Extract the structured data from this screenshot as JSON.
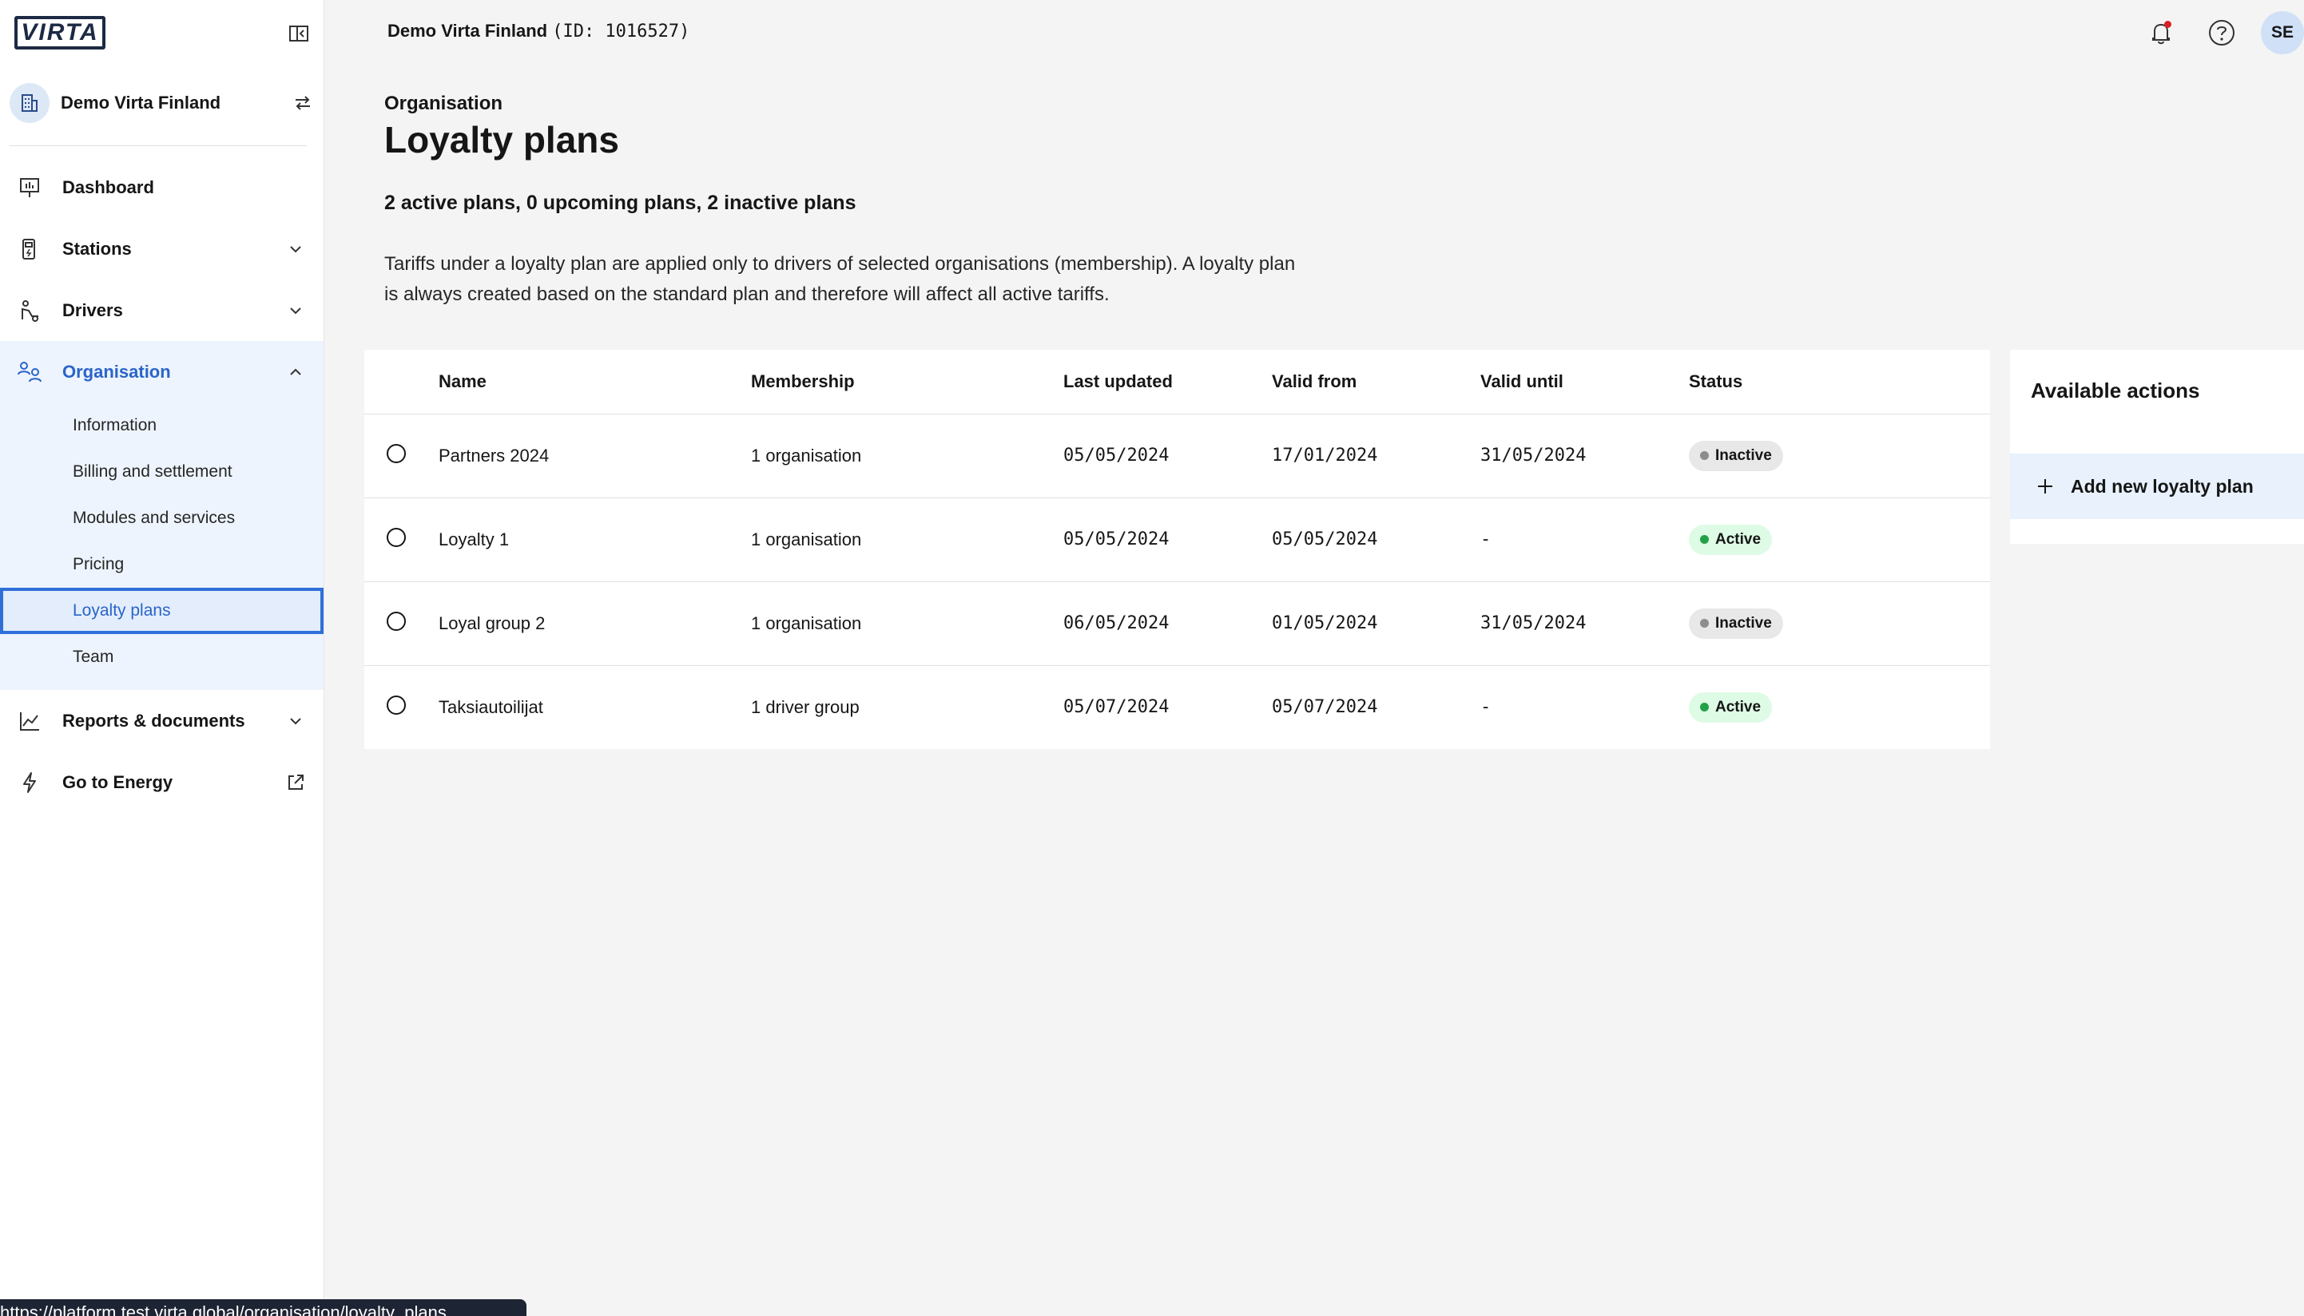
{
  "app": {
    "logo_text": "VIRTA",
    "brand_color": "#1c2a44",
    "accent_color": "#2a64c9"
  },
  "header": {
    "org_name": "Demo Virta Finland",
    "org_id": "(ID: 1016527)",
    "user_initials": "SE"
  },
  "sidebar": {
    "org_name": "Demo Virta Finland",
    "nav": {
      "dashboard": "Dashboard",
      "stations": "Stations",
      "drivers": "Drivers",
      "organisation": "Organisation",
      "reports": "Reports & documents",
      "energy": "Go to Energy"
    },
    "org_sub": [
      "Information",
      "Billing and settlement",
      "Modules and services",
      "Pricing",
      "Loyalty plans",
      "Team"
    ]
  },
  "page": {
    "breadcrumb": "Organisation",
    "title": "Loyalty plans",
    "summary": "2 active plans, 0 upcoming plans, 2 inactive plans",
    "description": "Tariffs under a loyalty plan are applied only to drivers of selected organisations (membership). A loyalty plan is always created based on the standard plan and therefore will affect all active tariffs."
  },
  "table": {
    "headers": {
      "name": "Name",
      "membership": "Membership",
      "last_updated": "Last updated",
      "valid_from": "Valid from",
      "valid_until": "Valid until",
      "status": "Status"
    },
    "rows": [
      {
        "name": "Partners 2024",
        "membership": "1 organisation",
        "last_updated": "05/05/2024",
        "valid_from": "17/01/2024",
        "valid_until": "31/05/2024",
        "status": "Inactive"
      },
      {
        "name": "Loyalty 1",
        "membership": "1 organisation",
        "last_updated": "05/05/2024",
        "valid_from": "05/05/2024",
        "valid_until": "-",
        "status": "Active"
      },
      {
        "name": "Loyal group 2",
        "membership": "1 organisation",
        "last_updated": "06/05/2024",
        "valid_from": "01/05/2024",
        "valid_until": "31/05/2024",
        "status": "Inactive"
      },
      {
        "name": "Taksiautoilijat",
        "membership": "1 driver group",
        "last_updated": "05/07/2024",
        "valid_from": "05/07/2024",
        "valid_until": "-",
        "status": "Active"
      }
    ],
    "status_colors": {
      "Active": {
        "bg": "#defbe6",
        "dot": "#24a148"
      },
      "Inactive": {
        "bg": "#e8e8e8",
        "dot": "#8d8d8d"
      }
    }
  },
  "actions": {
    "title": "Available actions",
    "add_label": "Add new loyalty plan"
  },
  "status_url": "https://platform.test.virta.global/organisation/loyalty_plans"
}
